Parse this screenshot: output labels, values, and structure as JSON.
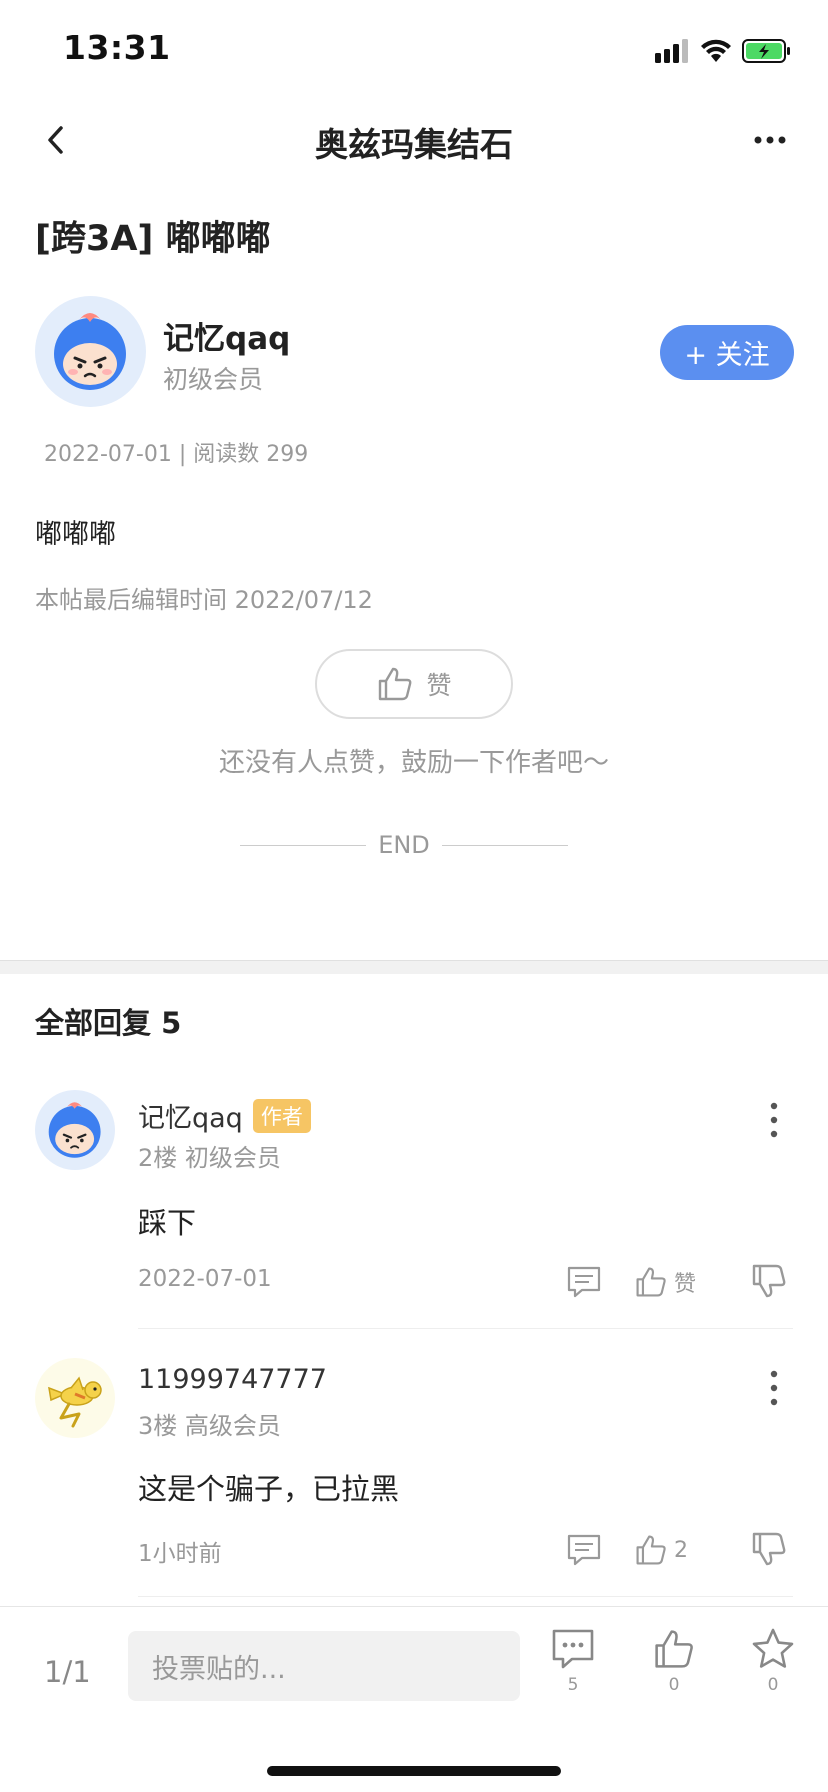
{
  "status_bar": {
    "time": "13:31"
  },
  "nav": {
    "title": "奥兹玛集结石"
  },
  "post": {
    "title": "[跨3A] 嘟嘟嘟",
    "author": {
      "name": "记忆qaq",
      "level": "初级会员"
    },
    "follow_label": "+ 关注",
    "meta": "2022-07-01 | 阅读数 299",
    "body": "嘟嘟嘟",
    "edit_note": "本帖最后编辑时间 2022/07/12",
    "like_label": "赞",
    "like_hint": "还没有人点赞，鼓励一下作者吧～",
    "end_label": "END"
  },
  "replies": {
    "header": "全部回复  5",
    "items": [
      {
        "name": "记忆qaq",
        "badge": "作者",
        "sub": "2楼 初级会员",
        "text": "踩下",
        "time": "2022-07-01",
        "like_label": "赞"
      },
      {
        "name": "11999747777",
        "sub": "3楼 高级会员",
        "text": "这是个骗子，已拉黑",
        "time": "1小时前",
        "like_label": "2"
      }
    ]
  },
  "bottom_bar": {
    "page": "1/1",
    "input_placeholder": "投票贴的...",
    "comment_count": "5",
    "like_count": "0",
    "favorite_count": "0"
  },
  "colors": {
    "accent": "#5b8ff0",
    "badge": "#f6c564",
    "muted_text": "#999999"
  },
  "icons": [
    "signal-icon",
    "wifi-icon",
    "battery-icon",
    "back-icon",
    "more-icon",
    "thumbs-up-icon",
    "thumbs-down-icon",
    "comment-icon",
    "star-icon"
  ]
}
